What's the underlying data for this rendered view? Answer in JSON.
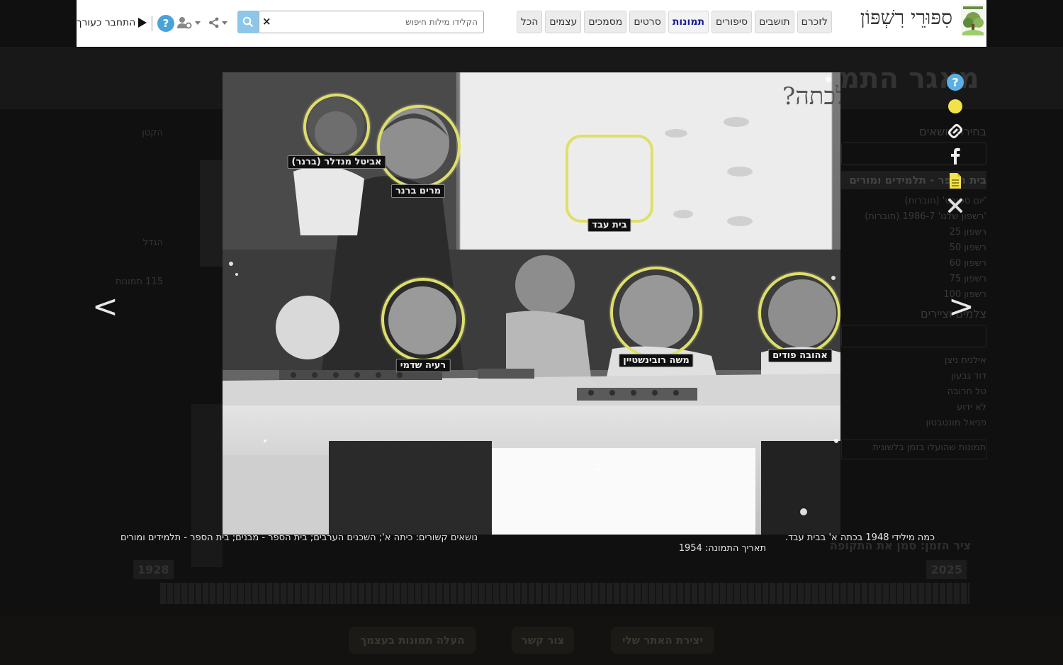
{
  "header": {
    "site_title": "סִפּוּרֵי רִשְׁפּוֹן",
    "logo_icon": "rishpon-tree-logo-icon",
    "tabs": [
      {
        "label": "לזכרם",
        "active": false
      },
      {
        "label": "תושבים",
        "active": false
      },
      {
        "label": "סיפורים",
        "active": false
      },
      {
        "label": "תמונות",
        "active": true
      },
      {
        "label": "סרטים",
        "active": false
      },
      {
        "label": "מסמכים",
        "active": false
      },
      {
        "label": "עצמים",
        "active": false
      },
      {
        "label": "הכל",
        "active": false
      }
    ],
    "search_placeholder": "הקלידו מילות חיפוש",
    "search_clear": "×",
    "login_label": "התחבר כעורך",
    "help_label": "?"
  },
  "lightbox": {
    "faces": [
      {
        "name": "אביטל מנדלר (ברנר)"
      },
      {
        "name": "מרים ברנר"
      },
      {
        "name": "בית עבד"
      },
      {
        "name": "רעיה שדמי"
      },
      {
        "name": "משה רובינשטיין"
      },
      {
        "name": "אהובה פודים"
      }
    ],
    "board_text": "מי בא לכתה?",
    "prev_arrow": "<",
    "next_arrow": ">",
    "caption_right": "כמה מילידי 1948 בכתה א' בבית עבד.",
    "caption_date": "תאריך התמונה: 1954",
    "caption_topics": "נושאים קשורים: כיתה א'; השכנים הערבים; בית הספר - מבנים; בית הספר - תלמידים ומורים",
    "tools": [
      "help-icon",
      "yellow-dot-icon",
      "link-icon",
      "facebook-icon",
      "document-icon",
      "close-icon"
    ]
  },
  "background": {
    "title": "מאגר התמונות",
    "right_heading": "בחירת נושאים",
    "right_selected": "בית הספר - תלמידים ומורים",
    "right_items": [
      "'יום ספורט' (חוברות)",
      "'רשפון שלנו' 1986-7 (חוברות)",
      "רשפון 25",
      "רשפון 50",
      "רשפון 60",
      "רשפון 75",
      "רשפון 100"
    ],
    "right_heading2": "צלמים וציירים",
    "right_items2": [
      "אילנית ניצן",
      "דוד גבעון",
      "טל חרובה",
      "לא ידוע",
      "פניאל מונטבטון"
    ],
    "right_box": "תמונות שהועלו בזמן בלשונית",
    "left_items": [
      "הקטן",
      "הגדל",
      "115 תמונות"
    ],
    "timeline_label": "ציר הזמן: סמן את התקופה",
    "year_start": "1928",
    "year_end": "2025",
    "footer_buttons": [
      "יצירת האתר שלי",
      "צור קשר",
      "העלה תמונות בעצמך"
    ]
  }
}
